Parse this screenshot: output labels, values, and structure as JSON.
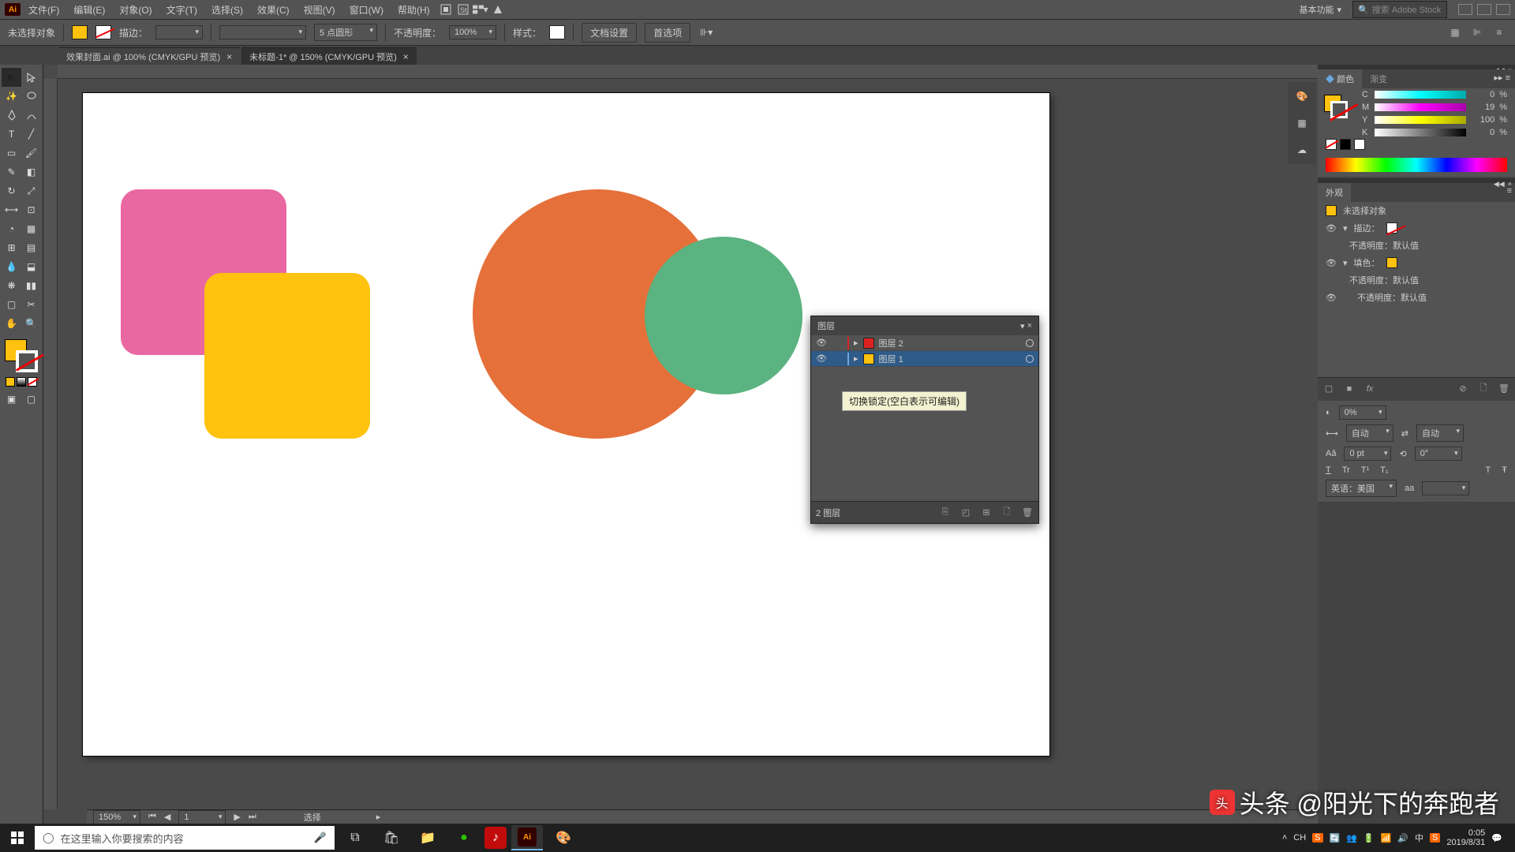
{
  "menu": {
    "items": [
      "文件(F)",
      "编辑(E)",
      "对象(O)",
      "文字(T)",
      "选择(S)",
      "效果(C)",
      "视图(V)",
      "窗口(W)",
      "帮助(H)"
    ]
  },
  "app_mode": "基本功能",
  "search_placeholder": "搜索 Adobe Stock",
  "options": {
    "no_selection": "未选择对象",
    "stroke_label": "描边：",
    "stroke_weight": "5 点圆形",
    "opacity_label": "不透明度：",
    "opacity_value": "100%",
    "style_label": "样式：",
    "doc_setup": "文档设置",
    "prefs": "首选项"
  },
  "tabs": {
    "t1": "效果封面.ai @ 100% (CMYK/GPU 预览)",
    "t2": "未标题-1* @ 150% (CMYK/GPU 预览)"
  },
  "layers": {
    "title": "图层",
    "rows": [
      {
        "name": "图层 2"
      },
      {
        "name": "图层 1"
      }
    ],
    "footer": "2 图层",
    "tooltip": "切换锁定(空白表示可编辑)"
  },
  "status": {
    "zoom": "150%",
    "page": "1",
    "mode": "选择"
  },
  "color": {
    "tab1": "颜色",
    "tab2": "渐变",
    "c": "0",
    "m": "19",
    "y": "100",
    "k": "0"
  },
  "appearance": {
    "title": "外观",
    "no_sel": "未选择对象",
    "stroke": "描边：",
    "opacity": "不透明度：默认值",
    "fill": "填色："
  },
  "char": {
    "opacity": "0%",
    "auto": "自动",
    "pt": "0 pt",
    "deg": "0°",
    "lang": "英语：美国"
  },
  "taskbar": {
    "search": "在这里输入你要搜索的内容",
    "ime": "CH",
    "time": "0:05",
    "date": "2019/8/31"
  },
  "watermark": "头条 @阳光下的奔跑者"
}
